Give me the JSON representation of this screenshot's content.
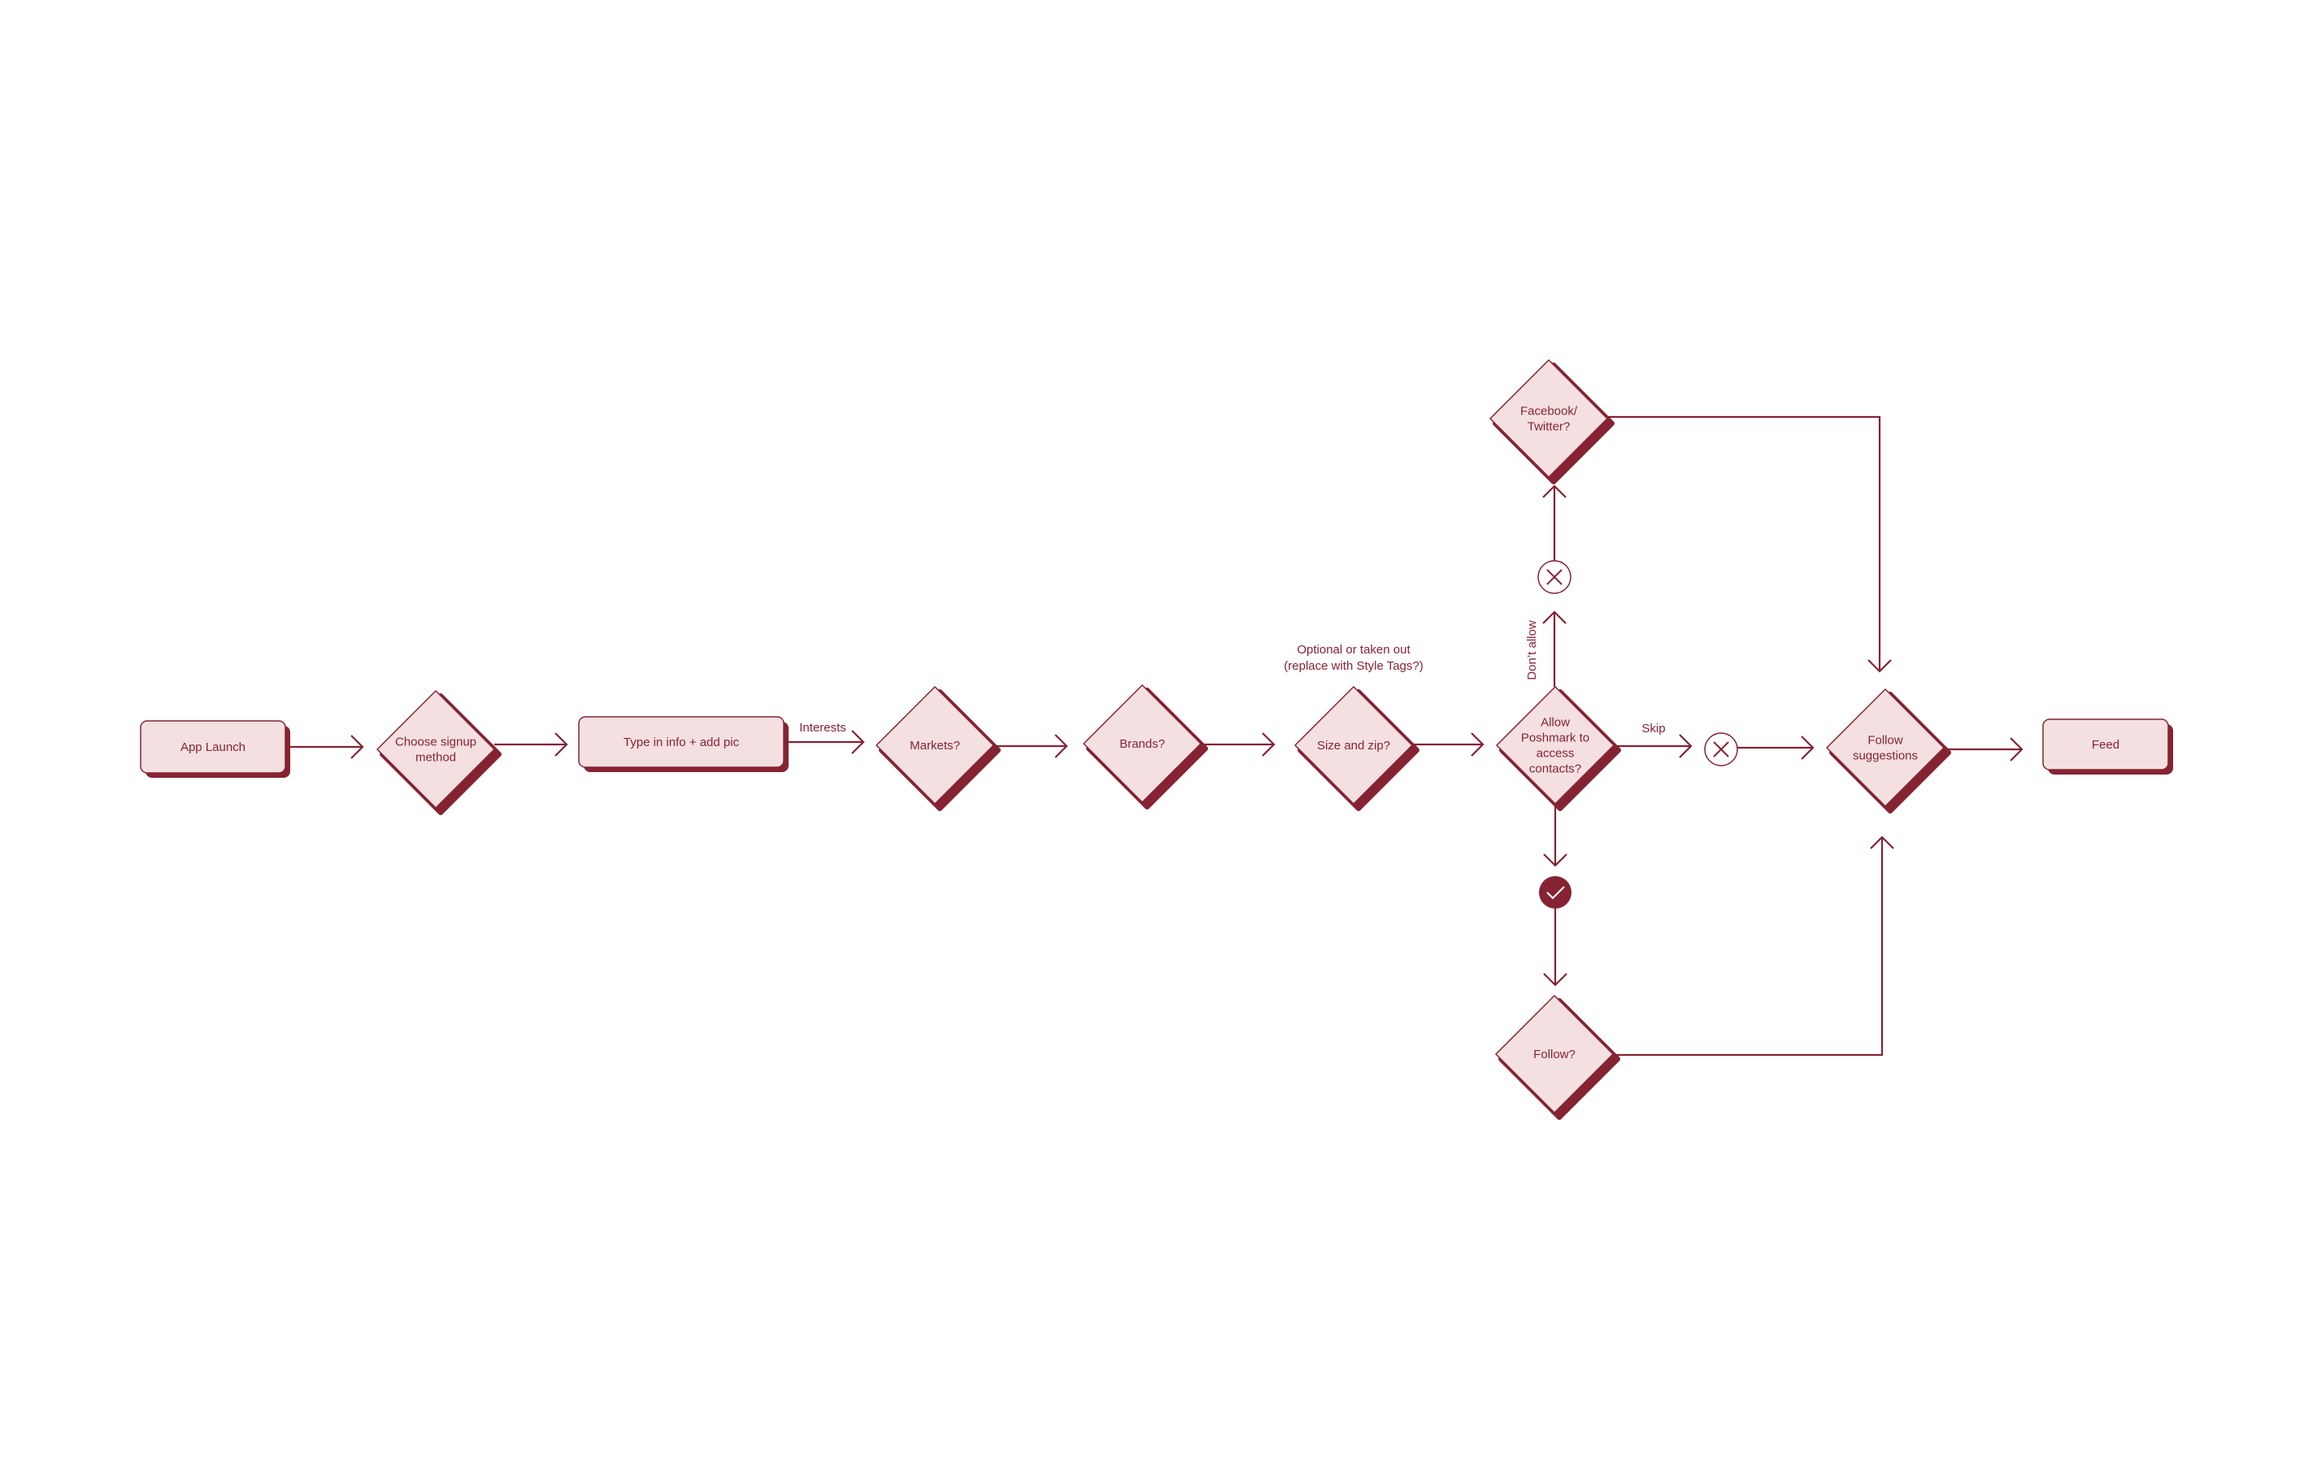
{
  "colors": {
    "stroke": "#852333",
    "fill": "#f4e0e1",
    "shadow": "#852333",
    "background": "#ffffff",
    "check_fill": "#852333",
    "check_mark": "#ffffff"
  },
  "nodes": [
    {
      "id": "app-launch",
      "shape": "rect",
      "lines": [
        "App Launch"
      ]
    },
    {
      "id": "choose-signup",
      "shape": "diamond",
      "lines": [
        "Choose signup",
        "method"
      ]
    },
    {
      "id": "type-info",
      "shape": "rect",
      "lines": [
        "Type in info + add pic"
      ]
    },
    {
      "id": "markets",
      "shape": "diamond",
      "lines": [
        "Markets?"
      ]
    },
    {
      "id": "brands",
      "shape": "diamond",
      "lines": [
        "Brands?"
      ]
    },
    {
      "id": "size-zip",
      "shape": "diamond",
      "lines": [
        "Size and zip?"
      ]
    },
    {
      "id": "allow-contacts",
      "shape": "diamond",
      "lines": [
        "Allow",
        "Poshmark to",
        "access",
        "contacts?"
      ]
    },
    {
      "id": "facebook-twitter",
      "shape": "diamond",
      "lines": [
        "Facebook/",
        "Twitter?"
      ]
    },
    {
      "id": "follow",
      "shape": "diamond",
      "lines": [
        "Follow?"
      ]
    },
    {
      "id": "follow-suggestions",
      "shape": "diamond",
      "lines": [
        "Follow",
        "suggestions"
      ]
    },
    {
      "id": "feed",
      "shape": "rect",
      "lines": [
        "Feed"
      ]
    }
  ],
  "markers": [
    {
      "id": "x-dont-allow",
      "type": "x-circle",
      "icon": "close-circle-icon"
    },
    {
      "id": "x-skip",
      "type": "x-circle",
      "icon": "close-circle-icon"
    },
    {
      "id": "check-allow",
      "type": "check-circle",
      "icon": "check-circle-icon"
    }
  ],
  "edges": [
    {
      "from": "app-launch",
      "to": "choose-signup",
      "label": ""
    },
    {
      "from": "choose-signup",
      "to": "type-info",
      "label": ""
    },
    {
      "from": "type-info",
      "to": "markets",
      "label": "Interests"
    },
    {
      "from": "markets",
      "to": "brands",
      "label": ""
    },
    {
      "from": "brands",
      "to": "size-zip",
      "label": ""
    },
    {
      "from": "size-zip",
      "to": "allow-contacts",
      "label": ""
    },
    {
      "from": "allow-contacts",
      "to": "x-dont-allow",
      "label": "Don’t allow"
    },
    {
      "from": "x-dont-allow",
      "to": "facebook-twitter",
      "label": ""
    },
    {
      "from": "allow-contacts",
      "to": "x-skip",
      "label": "Skip"
    },
    {
      "from": "x-skip",
      "to": "follow-suggestions",
      "label": ""
    },
    {
      "from": "allow-contacts",
      "to": "check-allow",
      "label": ""
    },
    {
      "from": "check-allow",
      "to": "follow",
      "label": ""
    },
    {
      "from": "facebook-twitter",
      "to": "follow-suggestions",
      "label": ""
    },
    {
      "from": "follow",
      "to": "follow-suggestions",
      "label": ""
    },
    {
      "from": "follow-suggestions",
      "to": "feed",
      "label": ""
    }
  ],
  "annotations": {
    "size_zip_note": [
      "Optional or taken out",
      "(replace with Style Tags?)"
    ]
  }
}
